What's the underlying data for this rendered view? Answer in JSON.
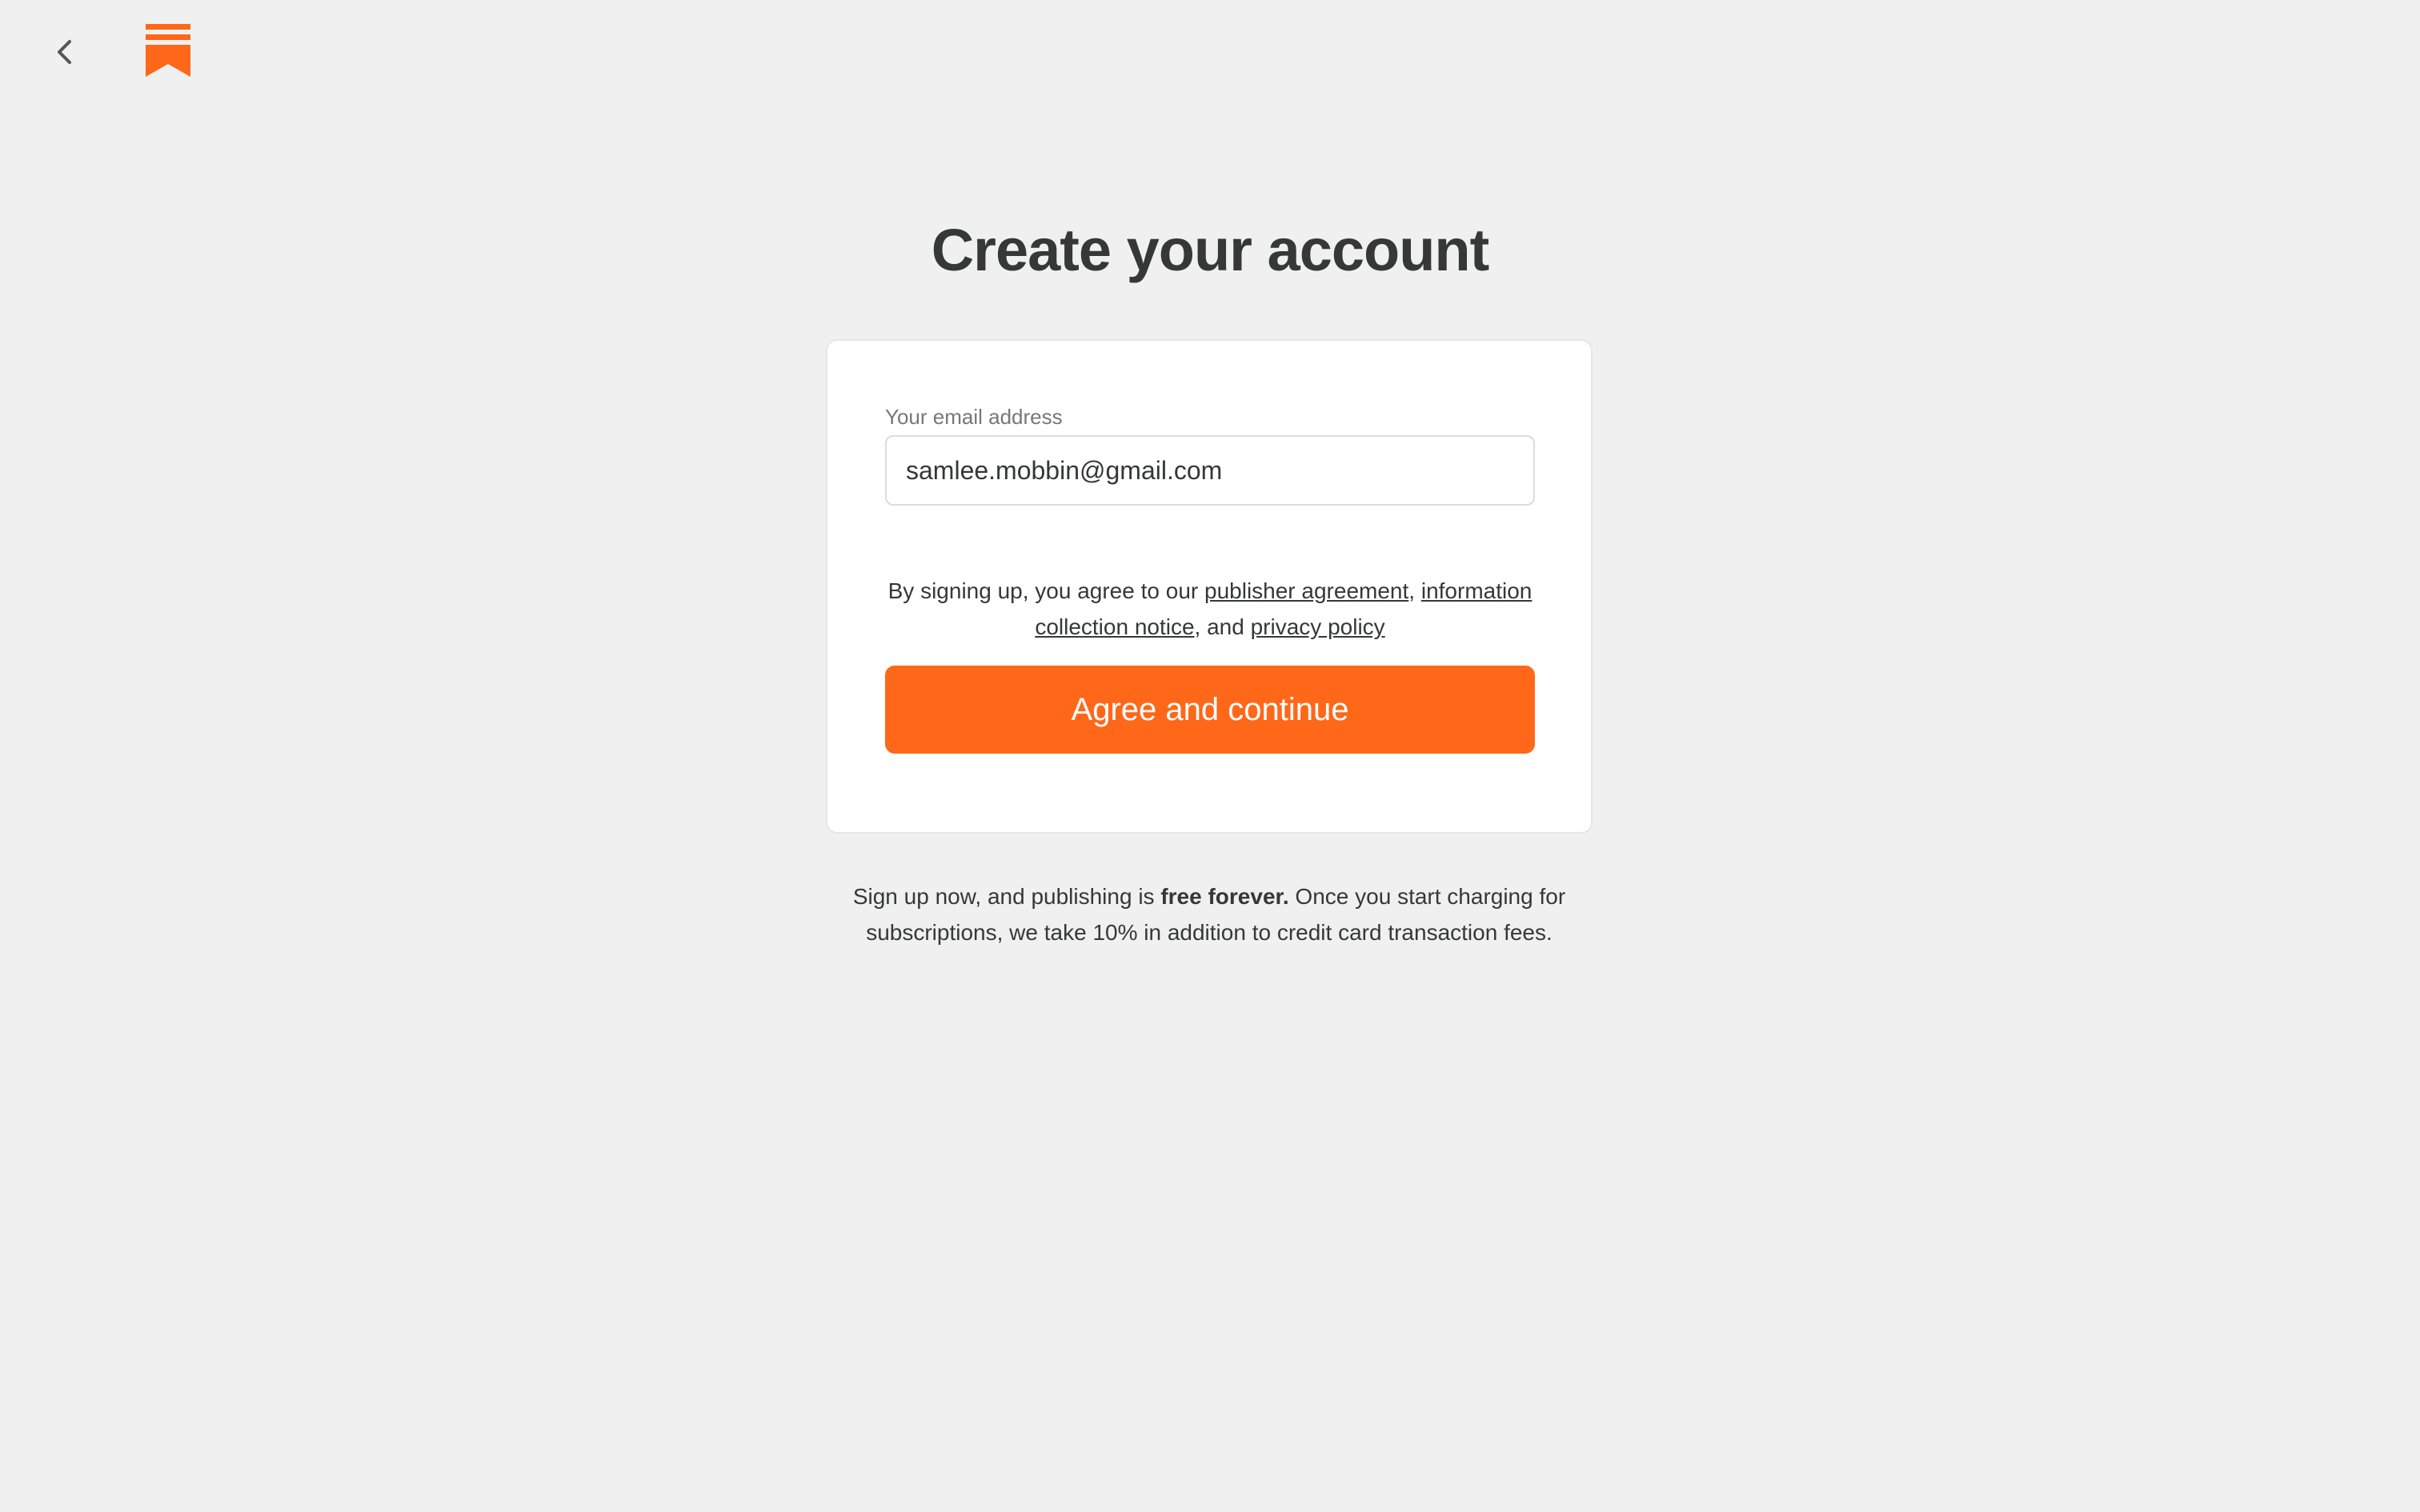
{
  "header": {
    "back_icon": "chevron-left-icon",
    "logo_icon": "substack-bookmark-logo",
    "logo_color": "#ff6719"
  },
  "main": {
    "title": "Create your account"
  },
  "form": {
    "email_label": "Your email address",
    "email_value": "samlee.mobbin@gmail.com",
    "terms_prefix": "By signing up, you agree to our ",
    "publisher_agreement_link": "publisher agreement",
    "comma_sep": ", ",
    "information_notice_link": "information collection notice",
    "and_sep": ", and ",
    "privacy_policy_link": "privacy policy",
    "submit_label": "Agree and continue",
    "button_color": "#ff6719"
  },
  "footer": {
    "note_prefix": "Sign up now, and publishing is ",
    "note_bold": "free forever.",
    "note_suffix": " Once you start charging for subscriptions, we take 10% in addition to credit card transaction fees."
  }
}
